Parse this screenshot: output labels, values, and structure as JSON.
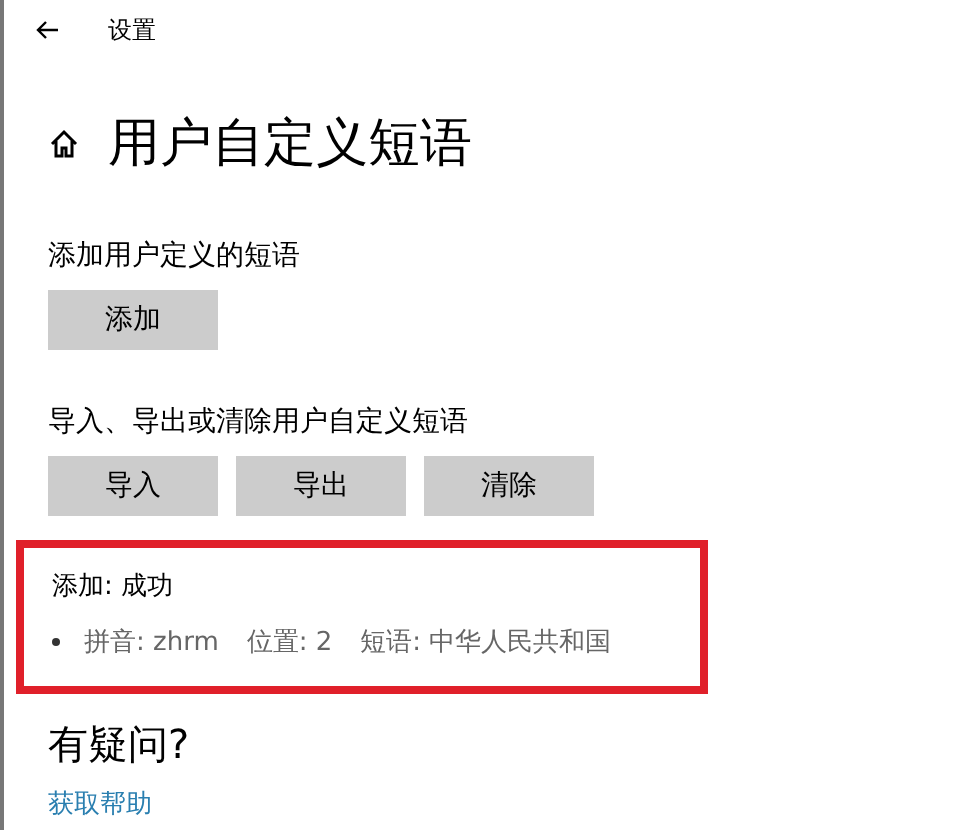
{
  "window": {
    "title": "设置"
  },
  "page_title": "用户自定义短语",
  "sections": [
    {
      "label": "添加用户定义的短语",
      "buttons": [
        "添加"
      ]
    },
    {
      "label": "导入、导出或清除用户自定义短语",
      "buttons": [
        "导入",
        "导出",
        "清除"
      ]
    }
  ],
  "result": {
    "title": "添加: 成功",
    "details": [
      "拼音: zhrm",
      "位置: 2",
      "短语: 中华人民共和国"
    ]
  },
  "help": {
    "heading": "有疑问?",
    "link": "获取帮助"
  }
}
